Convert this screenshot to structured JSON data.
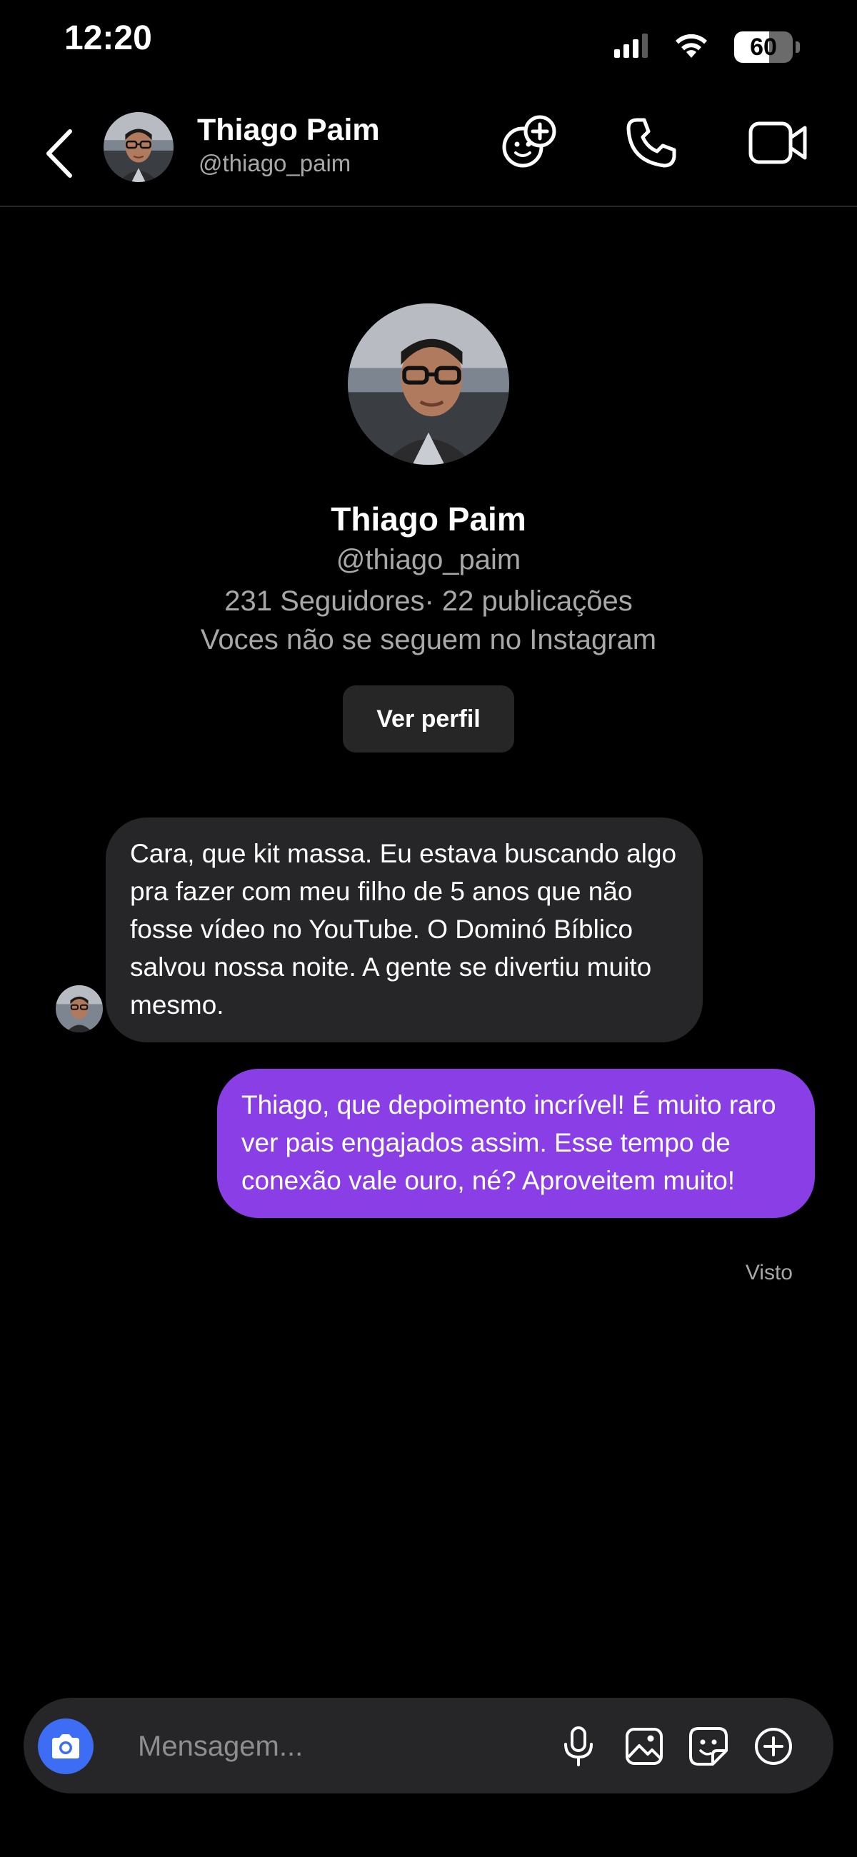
{
  "status_bar": {
    "time": "12:20",
    "battery_level": "60",
    "battery_fraction": 0.6,
    "icons": [
      "cellular-signal-icon",
      "wifi-icon",
      "battery-icon"
    ]
  },
  "header": {
    "name": "Thiago Paim",
    "handle": "@thiago_paim",
    "icons": [
      "back-chevron-icon",
      "add-effect-icon",
      "phone-icon",
      "video-camera-icon"
    ]
  },
  "profile": {
    "name": "Thiago Paim",
    "handle": "@thiago_paim",
    "stats": "231 Seguidores· 22 publicações",
    "note": "Voces não se seguem no Instagram",
    "view_profile_label": "Ver perfil"
  },
  "messages": [
    {
      "direction": "incoming",
      "text": "Cara, que kit massa. Eu estava buscando algo pra fazer com meu filho de 5 anos que não fosse vídeo no YouTube. O Dominó Bíblico salvou nossa noite. A gente se divertiu muito mesmo."
    },
    {
      "direction": "outgoing",
      "text": "Thiago, que depoimento incrível! É muito raro ver pais engajados assim. Esse tempo de conexão vale ouro, né? Aproveitem muito!"
    }
  ],
  "seen_label": "Visto",
  "composer": {
    "placeholder": "Mensagem...",
    "icons": [
      "camera-icon",
      "microphone-icon",
      "gallery-icon",
      "sticker-icon",
      "plus-circle-icon"
    ]
  },
  "colors": {
    "background": "#000000",
    "incoming_bubble": "#262629",
    "outgoing_bubble": "#8a3ee6",
    "camera_button": "#3d6df5",
    "secondary_text": "#a8a8a8"
  }
}
